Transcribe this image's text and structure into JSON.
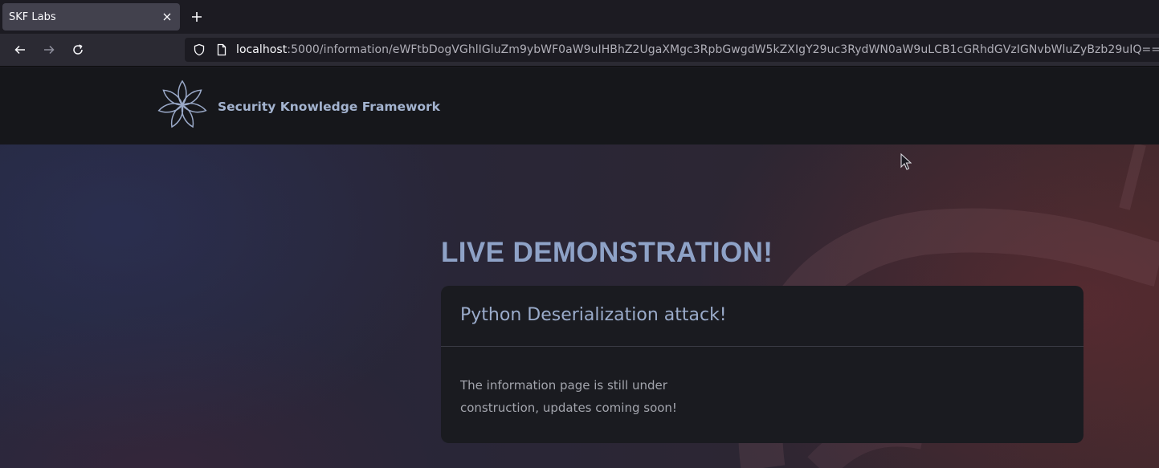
{
  "browser": {
    "tab": {
      "title": "SKF Labs",
      "close_icon": "close-icon"
    },
    "new_tab_icon": "plus-icon",
    "url": {
      "host": "localhost",
      "rest": ":5000/information/eWFtbDogVGhlIGluZm9ybWF0aW9uIHBhZ2UgaXMgc3RpbGwgdW5kZXIgY29uc3RydWN0aW9uLCB1cGRhdGVzIGNvbWluZyBzb29uIQ=="
    }
  },
  "site": {
    "brand": "Security Knowledge Framework",
    "logo_icon": "flower-logo-icon"
  },
  "hero": {
    "title": "LIVE DEMONSTRATION!"
  },
  "card": {
    "title": "Python Deserialization attack!",
    "body": "The information page is still under construction, updates coming soon!"
  },
  "colors": {
    "header_bg": "#16171b",
    "accent_text": "#8ea2c7",
    "card_bg": "#1a1b20"
  }
}
